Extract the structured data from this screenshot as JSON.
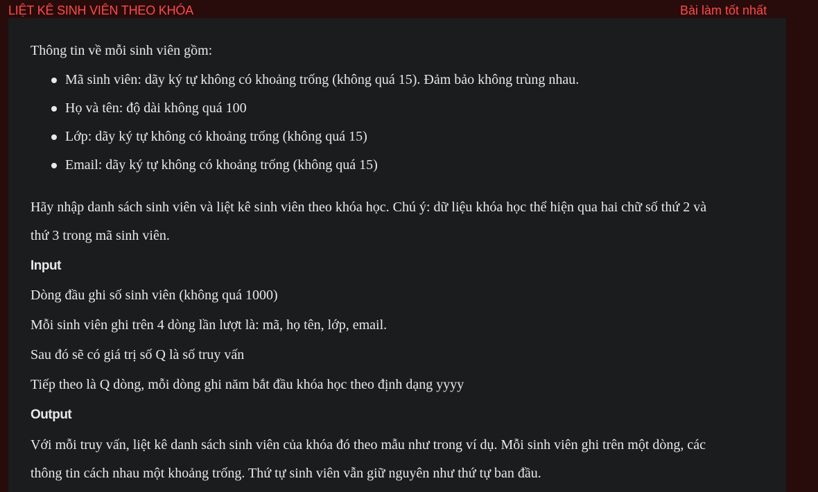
{
  "header": {
    "title": "LIỆT KÊ SINH VIÊN THEO KHÓA",
    "best_submission_link": "Bài làm tốt nhất"
  },
  "problem": {
    "intro": "Thông tin về mỗi sinh viên gồm:",
    "fields": [
      "Mã sinh viên: dãy ký tự không có khoảng trống (không quá 15). Đảm bảo không trùng nhau.",
      "Họ và tên: độ dài không quá 100",
      "Lớp: dãy ký tự không có khoảng trống (không quá 15)",
      "Email: dãy ký tự không có khoảng trống (không quá 15)"
    ],
    "task_line1": "Hãy nhập danh sách sinh viên và liệt kê sinh viên theo khóa học. Chú ý: dữ liệu khóa học thể hiện qua hai chữ số thứ 2 và",
    "task_line2": "thứ 3 trong mã sinh viên.",
    "input_heading": "Input",
    "input_lines": [
      "Dòng đầu ghi số sinh viên (không quá 1000)",
      "Mỗi sinh viên ghi trên 4 dòng lần lượt là: mã, họ tên, lớp, email.",
      "Sau đó sẽ có giá trị số Q là số truy vấn",
      "Tiếp theo là Q dòng, mỗi dòng ghi năm bắt đầu khóa học theo định dạng yyyy"
    ],
    "output_heading": "Output",
    "output_line1": "Với mỗi truy vấn, liệt kê danh sách sinh viên của khóa đó theo mẫu như trong ví dụ. Mỗi sinh viên ghi trên một dòng, các",
    "output_line2": "thông tin cách nhau một khoảng trống. Thứ tự sinh viên vẫn giữ nguyên như thứ tự ban đầu."
  }
}
